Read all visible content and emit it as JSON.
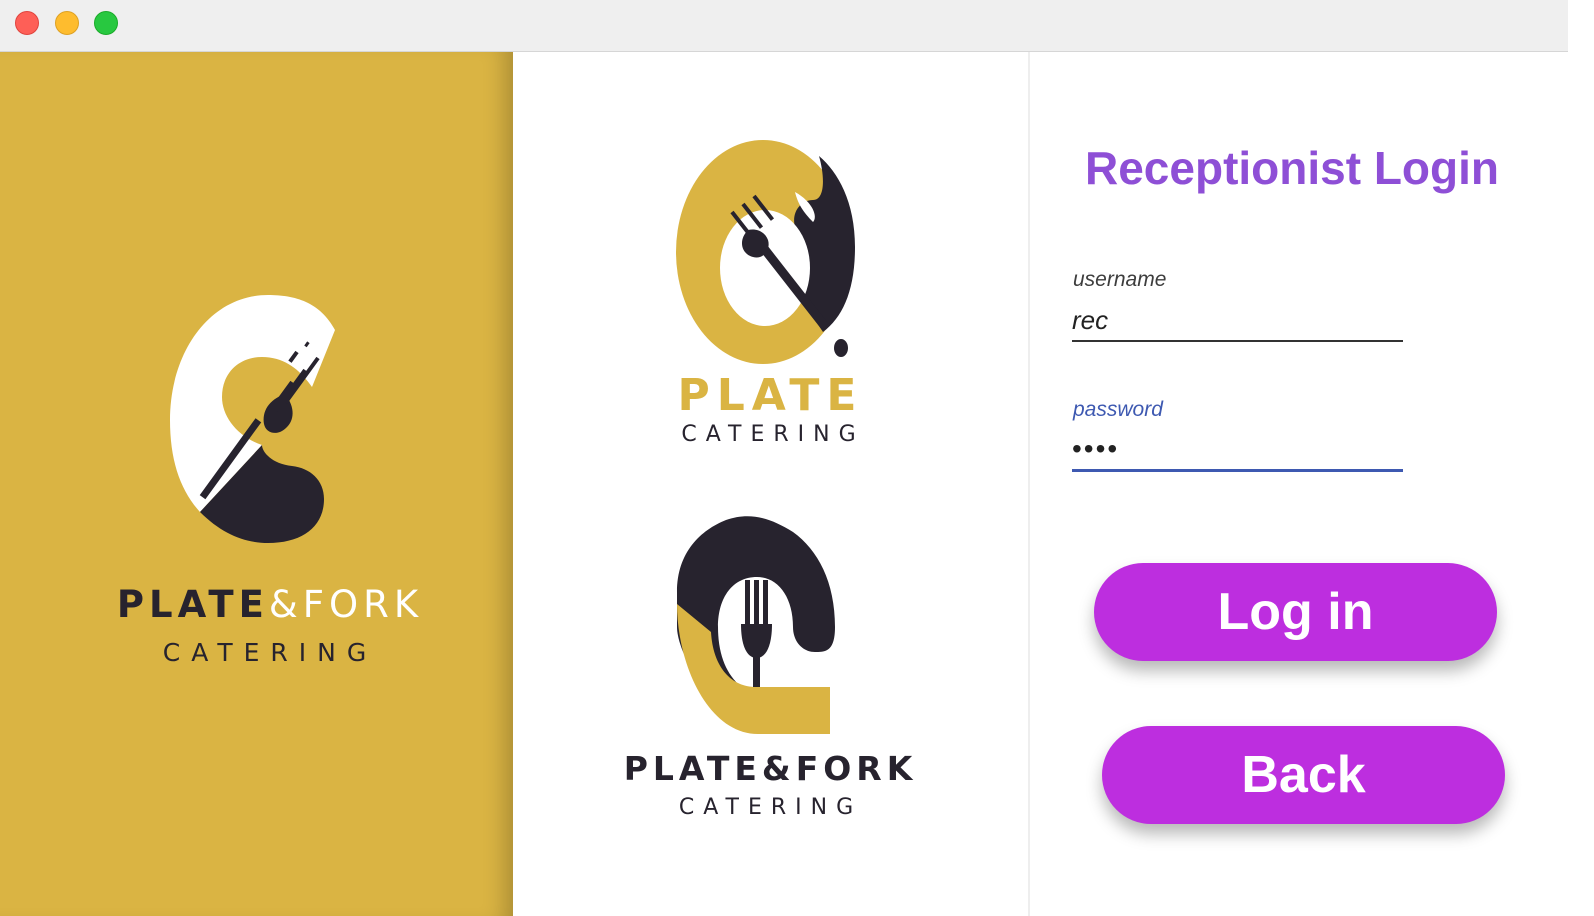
{
  "window": {
    "controls": [
      "close",
      "minimize",
      "maximize"
    ]
  },
  "left_logo": {
    "name_bold": "PLATE",
    "name_light": "&FORK",
    "subtitle": "CATERING"
  },
  "plate_logo": {
    "name": "PLATE",
    "subtitle": "CATERING"
  },
  "pf_logo": {
    "name": "PLATE&FORK",
    "subtitle": "CATERING"
  },
  "login": {
    "title": "Receptionist Login",
    "username_label": "username",
    "username_value": "rec",
    "password_label": "password",
    "password_value": "abcd",
    "login_button": "Log in",
    "back_button": "Back"
  },
  "colors": {
    "brand_gold": "#dab443",
    "brand_dark": "#27232e",
    "title_purple": "#8e4fd6",
    "button_magenta": "#bd2edf",
    "focus_blue": "#3e59b1"
  }
}
